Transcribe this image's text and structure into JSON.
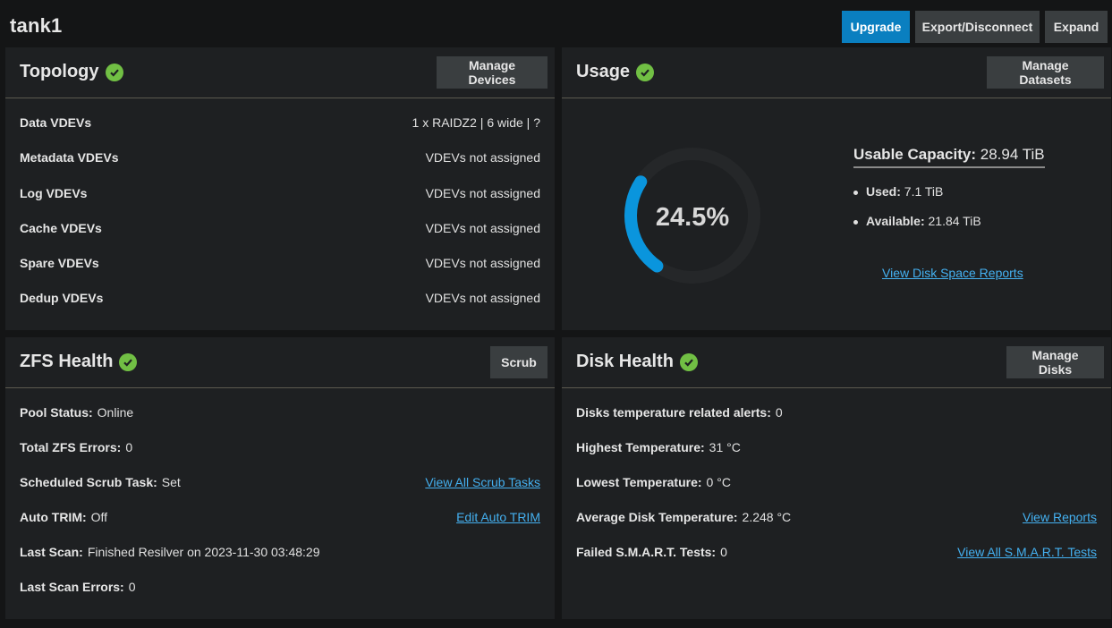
{
  "pool": {
    "name": "tank1"
  },
  "actions": {
    "upgrade": "Upgrade",
    "export": "Export/Disconnect",
    "expand": "Expand"
  },
  "colors": {
    "accent": "#0a7fc0",
    "ok": "#71bf44",
    "link": "#44b0f0",
    "card": "#1e2022",
    "page": "#141516"
  },
  "topology": {
    "title": "Topology",
    "button": "Manage Devices",
    "rows": [
      {
        "label": "Data VDEVs",
        "value": "1 x RAIDZ2 | 6 wide | ?"
      },
      {
        "label": "Metadata VDEVs",
        "value": "VDEVs not assigned"
      },
      {
        "label": "Log VDEVs",
        "value": "VDEVs not assigned"
      },
      {
        "label": "Cache VDEVs",
        "value": "VDEVs not assigned"
      },
      {
        "label": "Spare VDEVs",
        "value": "VDEVs not assigned"
      },
      {
        "label": "Dedup VDEVs",
        "value": "VDEVs not assigned"
      }
    ]
  },
  "usage": {
    "title": "Usage",
    "button": "Manage Datasets",
    "percent_label": "24.5%",
    "percent_value": 24.5,
    "capacity_label": "Usable Capacity:",
    "capacity_value": "28.94 TiB",
    "used_label": "Used:",
    "used_value": "7.1 TiB",
    "available_label": "Available:",
    "available_value": "21.84 TiB",
    "link": "View Disk Space Reports"
  },
  "zfs": {
    "title": "ZFS Health",
    "button": "Scrub",
    "rows": [
      {
        "label": "Pool Status:",
        "value": "Online",
        "link": ""
      },
      {
        "label": "Total ZFS Errors:",
        "value": "0",
        "link": ""
      },
      {
        "label": "Scheduled Scrub Task:",
        "value": "Set",
        "link": "View All Scrub Tasks"
      },
      {
        "label": "Auto TRIM:",
        "value": "Off",
        "link": "Edit Auto TRIM"
      },
      {
        "label": "Last Scan:",
        "value": "Finished Resilver on 2023-11-30 03:48:29",
        "link": ""
      },
      {
        "label": "Last Scan Errors:",
        "value": "0",
        "link": ""
      }
    ]
  },
  "disk": {
    "title": "Disk Health",
    "button": "Manage Disks",
    "rows": [
      {
        "label": "Disks temperature related alerts:",
        "value": "0",
        "link": ""
      },
      {
        "label": "Highest Temperature:",
        "value": "31 °C",
        "link": ""
      },
      {
        "label": "Lowest Temperature:",
        "value": "0 °C",
        "link": ""
      },
      {
        "label": "Average Disk Temperature:",
        "value": "2.248 °C",
        "link": "View Reports"
      },
      {
        "label": "Failed S.M.A.R.T. Tests:",
        "value": "0",
        "link": "View All S.M.A.R.T. Tests"
      }
    ]
  }
}
